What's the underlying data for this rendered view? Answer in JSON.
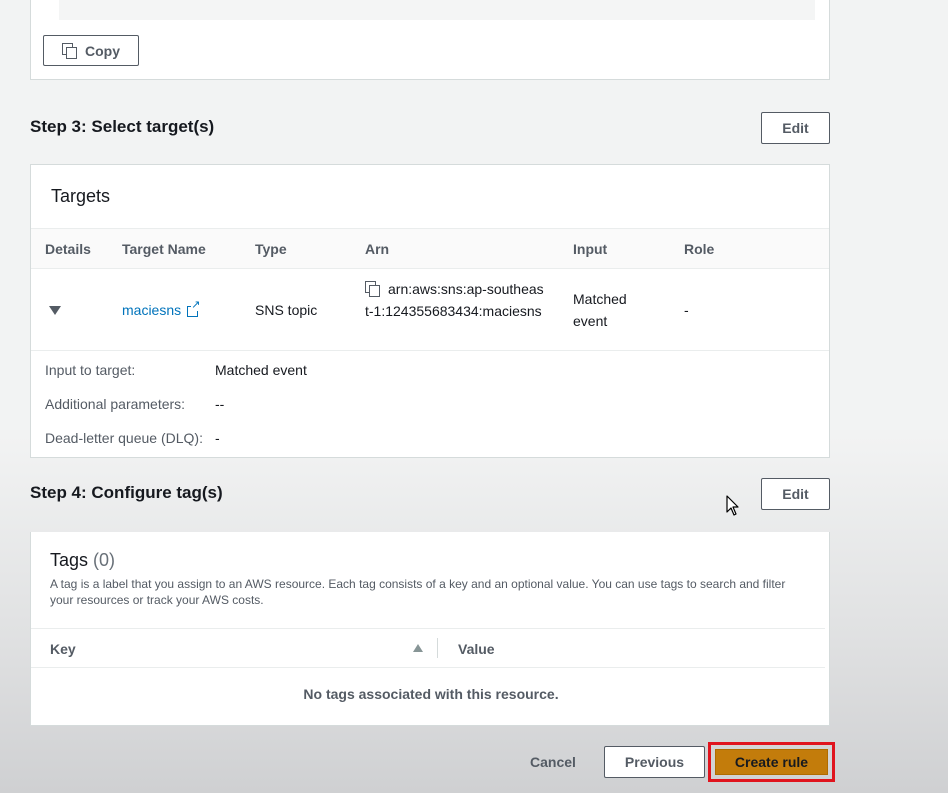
{
  "top_panel": {
    "copy_label": "Copy"
  },
  "step3": {
    "title": "Step 3: Select target(s)",
    "edit_label": "Edit",
    "panel_title": "Targets",
    "columns": [
      "Details",
      "Target Name",
      "Type",
      "Arn",
      "Input",
      "Role"
    ],
    "row": {
      "target_name": "maciesns",
      "type": "SNS topic",
      "arn": "arn:aws:sns:ap-southeast-1:124355683434:maciesns",
      "input": "Matched event",
      "role": "-"
    },
    "details": [
      {
        "label": "Input to target:",
        "value": "Matched event"
      },
      {
        "label": "Additional parameters:",
        "value": "--"
      },
      {
        "label": "Dead-letter queue (DLQ):",
        "value": "-"
      }
    ]
  },
  "step4": {
    "title": "Step 4: Configure tag(s)",
    "edit_label": "Edit",
    "panel_title": "Tags",
    "count": "(0)",
    "description": "A tag is a label that you assign to an AWS resource. Each tag consists of a key and an optional value. You can use tags to search and filter your resources or track your AWS costs.",
    "columns": {
      "key": "Key",
      "value": "Value"
    },
    "empty_message": "No tags associated with this resource."
  },
  "footer": {
    "cancel_label": "Cancel",
    "previous_label": "Previous",
    "create_label": "Create rule"
  },
  "colors": {
    "primary_button": "#c37c0b",
    "highlight_border": "#e0141e",
    "link": "#0073bb"
  }
}
